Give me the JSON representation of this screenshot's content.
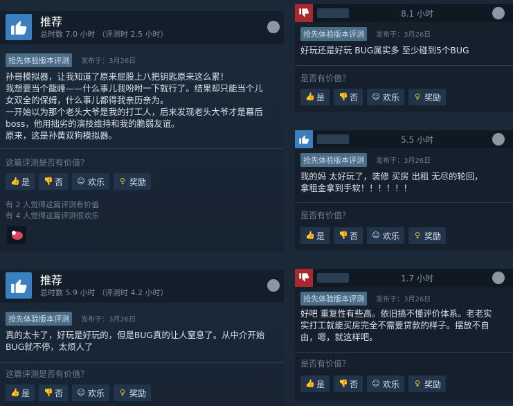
{
  "common": {
    "early_access_tag": "抢先体验版本评测",
    "helpful_question_long": "这篇评测是否有价值？",
    "helpful_question_short": "是否有价值？",
    "btn_yes": "是",
    "btn_no": "否",
    "btn_funny": "欢乐",
    "btn_award": "奖励"
  },
  "left_reviews": [
    {
      "verdict": "推荐",
      "hours": "总时数 7.0 小时 （评测时 2.5 小时）",
      "posted": "发布于：3月26日",
      "text_lines": [
        "孙哥模拟器，让我知道了原来屁股上八把钥匙原来这么累！",
        "我想要当个龍峰——什么事儿我吩咐一下就行了。结果却只能当个儿",
        "女双全的保姆，什么事儿都得我亲历亲为。",
        "一开始以为那个老头大爷是我的打工人，后来发现老头大爷才是幕后",
        "boss，他用拙劣的演技维持和我的脆弱友谊。",
        "原来，这是孙黄双狗模拟器。"
      ],
      "stat1": "有 2 人觉得这篇评测有价值",
      "stat2": "有 4 人觉得这篇评测很欢乐"
    },
    {
      "verdict": "推荐",
      "hours": "总时数 5.9 小时 （评测时 4.2 小时）",
      "posted": "发布于：3月26日",
      "text_lines": [
        "真的太卡了，好玩是好玩的，但是BUG真的让人窒息了。从中介开始",
        "BUG就不停，太烦人了"
      ]
    }
  ],
  "right_reviews": [
    {
      "hours": "8.1 小时",
      "posted": "发布于：3月26日",
      "text_lines": [
        "好玩还是好玩 BUG属实多 至少碰到5个BUG"
      ]
    },
    {
      "hours": "5.5 小时",
      "posted": "发布于：3月26日",
      "text_lines": [
        "我的妈 太好玩了，装修 买房 出租 无尽的轮回，",
        "拿租金拿到手软！！！！！！"
      ]
    },
    {
      "hours": "1.7 小时",
      "posted": "发布于：3月26日",
      "text_lines": [
        "好吧 重复性有些高。依旧搞不懂评价体系。老老实",
        "实打工就能买房完全不需要贷款的样子。摆放不自",
        "由，嗯，就这样吧。"
      ]
    }
  ]
}
